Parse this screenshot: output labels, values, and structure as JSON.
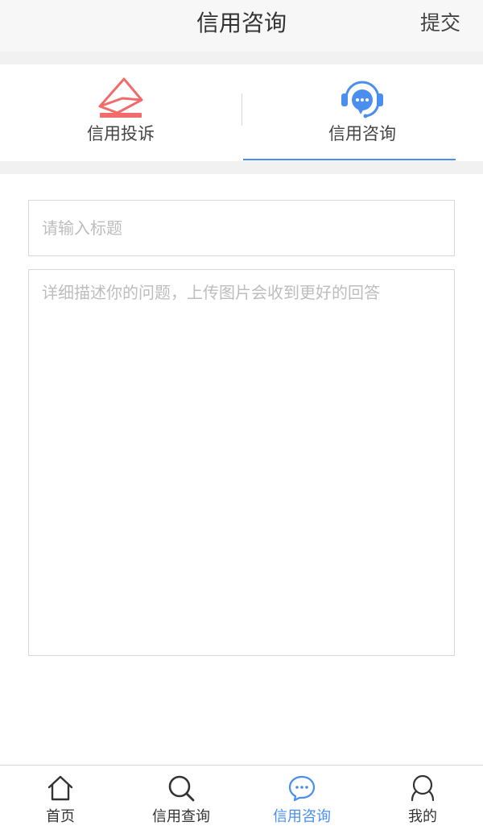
{
  "header": {
    "title": "信用咨询",
    "submit_label": "提交"
  },
  "category_tabs": [
    {
      "label": "信用投诉",
      "icon": "envelope-icon",
      "color": "#f26b6b",
      "active": false
    },
    {
      "label": "信用咨询",
      "icon": "customer-service-icon",
      "color": "#4a8ff0",
      "active": true
    }
  ],
  "form": {
    "title_placeholder": "请输入标题",
    "title_value": "",
    "description_placeholder": "详细描述你的问题，上传图片会收到更好的回答",
    "description_value": ""
  },
  "bottom_nav": [
    {
      "label": "首页",
      "icon": "home-icon",
      "active": false
    },
    {
      "label": "信用查询",
      "icon": "search-icon",
      "active": false
    },
    {
      "label": "信用咨询",
      "icon": "chat-bubble-icon",
      "active": true
    },
    {
      "label": "我的",
      "icon": "user-icon",
      "active": false
    }
  ],
  "colors": {
    "accent": "#4a8ff0",
    "complaint": "#f26b6b",
    "header_bg": "#f7f7f7",
    "separator_bg": "#f1f1f1"
  }
}
